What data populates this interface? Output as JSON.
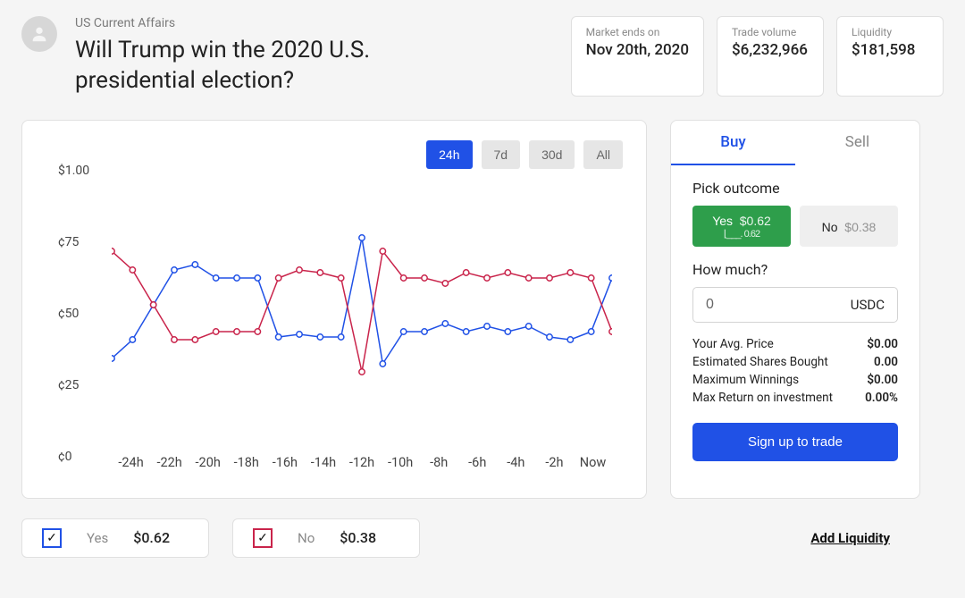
{
  "header": {
    "category": "US Current Affairs",
    "title": "Will Trump win the 2020 U.S. presidential election?",
    "stats": [
      {
        "label": "Market ends on",
        "value": "Nov 20th, 2020"
      },
      {
        "label": "Trade volume",
        "value": "$6,232,966"
      },
      {
        "label": "Liquidity",
        "value": "$181,598"
      }
    ]
  },
  "chart_data": {
    "type": "line",
    "title": "",
    "xlabel": "",
    "ylabel": "",
    "ylim": [
      0,
      100
    ],
    "y_ticks": [
      "$1.00",
      "¢75",
      "¢50",
      "¢25",
      "¢0"
    ],
    "x_ticks": [
      "-24h",
      "-22h",
      "-20h",
      "-18h",
      "-16h",
      "-14h",
      "-12h",
      "-10h",
      "-8h",
      "-6h",
      "-4h",
      "-2h",
      "Now"
    ],
    "x": [
      "-24h",
      "-23h",
      "-22h",
      "-21h",
      "-20h",
      "-19h",
      "-18h",
      "-17h",
      "-16h",
      "-15h",
      "-14h",
      "-13h",
      "-12h",
      "-11h",
      "-10h",
      "-9h",
      "-8h",
      "-7h",
      "-6h",
      "-5h",
      "-4h",
      "-3h",
      "-2h",
      "-1h",
      "Now"
    ],
    "series": [
      {
        "name": "Yes",
        "color": "#2051e6",
        "values": [
          30,
          37,
          50,
          63,
          65,
          60,
          60,
          60,
          38,
          39,
          38,
          38,
          75,
          28,
          40,
          40,
          43,
          40,
          42,
          40,
          42,
          38,
          37,
          40,
          60
        ]
      },
      {
        "name": "No",
        "color": "#c9244b",
        "values": [
          70,
          63,
          50,
          37,
          37,
          40,
          40,
          40,
          60,
          63,
          62,
          60,
          25,
          70,
          60,
          60,
          58,
          62,
          60,
          62,
          60,
          60,
          62,
          60,
          40
        ]
      }
    ],
    "periods": [
      "24h",
      "7d",
      "30d",
      "All"
    ],
    "active_period": "24h"
  },
  "trade": {
    "tabs": {
      "buy": "Buy",
      "sell": "Sell",
      "active": "buy"
    },
    "pick_label": "Pick outcome",
    "yes": {
      "label": "Yes",
      "price": "$0.62",
      "spark": "0.62"
    },
    "no": {
      "label": "No",
      "price": "$0.38"
    },
    "how_much_label": "How much?",
    "amount": "0",
    "currency": "USDC",
    "rows": [
      {
        "label": "Your Avg. Price",
        "value": "$0.00"
      },
      {
        "label": "Estimated Shares Bought",
        "value": "0.00"
      },
      {
        "label": "Maximum Winnings",
        "value": "$0.00"
      },
      {
        "label": "Max Return on investment",
        "value": "0.00%"
      }
    ],
    "cta": "Sign up to trade"
  },
  "legend": {
    "yes": {
      "label": "Yes",
      "price": "$0.62"
    },
    "no": {
      "label": "No",
      "price": "$0.38"
    }
  },
  "add_liquidity": "Add Liquidity"
}
